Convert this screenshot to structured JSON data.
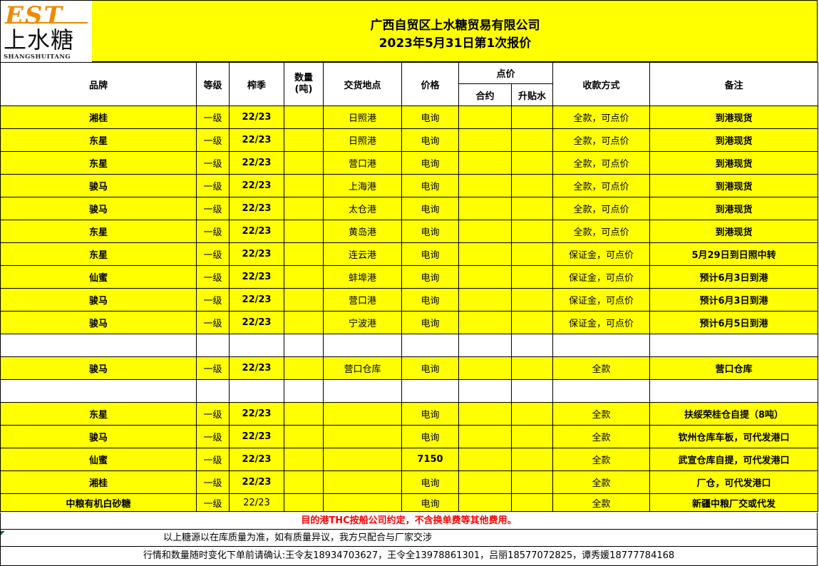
{
  "logo": {
    "mark": "EST",
    "name_cn": "上水糖",
    "name_en": "SHANGSHUITANG"
  },
  "title": {
    "company": "广西自贸区上水糖贸易有限公司",
    "date_line": "2023年5月31日第1次报价"
  },
  "headers": {
    "brand": "品牌",
    "grade": "等级",
    "season": "榨季",
    "qty_line1": "数量",
    "qty_line2": "(吨)",
    "location": "交货地点",
    "price": "价格",
    "point_price": "点价",
    "contract": "合约",
    "premium": "升贴水",
    "payment": "收款方式",
    "remark": "备注"
  },
  "rows": [
    {
      "brand": "湘桂",
      "grade": "一级",
      "season": "22/23",
      "qty": "",
      "location": "日照港",
      "price": "电询",
      "contract": "",
      "premium": "",
      "payment": "全款，可点价",
      "remark": "到港现货"
    },
    {
      "brand": "东星",
      "grade": "一级",
      "season": "22/23",
      "qty": "",
      "location": "日照港",
      "price": "电询",
      "contract": "",
      "premium": "",
      "payment": "全款，可点价",
      "remark": "到港现货"
    },
    {
      "brand": "东星",
      "grade": "一级",
      "season": "22/23",
      "qty": "",
      "location": "营口港",
      "price": "电询",
      "contract": "",
      "premium": "",
      "payment": "全款，可点价",
      "remark": "到港现货"
    },
    {
      "brand": "骏马",
      "grade": "一级",
      "season": "22/23",
      "qty": "",
      "location": "上海港",
      "price": "电询",
      "contract": "",
      "premium": "",
      "payment": "全款，可点价",
      "remark": "到港现货"
    },
    {
      "brand": "骏马",
      "grade": "一级",
      "season": "22/23",
      "qty": "",
      "location": "太仓港",
      "price": "电询",
      "contract": "",
      "premium": "",
      "payment": "全款，可点价",
      "remark": "到港现货"
    },
    {
      "brand": "东星",
      "grade": "一级",
      "season": "22/23",
      "qty": "",
      "location": "黄岛港",
      "price": "电询",
      "contract": "",
      "premium": "",
      "payment": "全款，可点价",
      "remark": "到港现货"
    },
    {
      "brand": "东星",
      "grade": "一级",
      "season": "22/23",
      "qty": "",
      "location": "连云港",
      "price": "电询",
      "contract": "",
      "premium": "",
      "payment": "保证金，可点价",
      "remark": "5月29日到日照中转"
    },
    {
      "brand": "仙蜜",
      "grade": "一级",
      "season": "22/23",
      "qty": "",
      "location": "蚌埠港",
      "price": "电询",
      "contract": "",
      "premium": "",
      "payment": "保证金，可点价",
      "remark": "预计6月3日到港"
    },
    {
      "brand": "骏马",
      "grade": "一级",
      "season": "22/23",
      "qty": "",
      "location": "营口港",
      "price": "电询",
      "contract": "",
      "premium": "",
      "payment": "保证金，可点价",
      "remark": "预计6月3日到港"
    },
    {
      "brand": "骏马",
      "grade": "一级",
      "season": "22/23",
      "qty": "",
      "location": "宁波港",
      "price": "电询",
      "contract": "",
      "premium": "",
      "payment": "保证金，可点价",
      "remark": "预计6月5日到港"
    }
  ],
  "rows_b": [
    {
      "brand": "骏马",
      "grade": "一级",
      "season": "22/23",
      "qty": "",
      "location": "营口仓库",
      "price": "电询",
      "contract": "",
      "premium": "",
      "payment": "全款",
      "remark": "营口仓库"
    }
  ],
  "rows_c": [
    {
      "brand": "东星",
      "grade": "一级",
      "season": "22/23",
      "qty": "",
      "location": "",
      "price": "电询",
      "contract": "",
      "premium": "",
      "payment": "全款",
      "remark": "扶绥荣桂仓自提（8吨）"
    },
    {
      "brand": "骏马",
      "grade": "一级",
      "season": "22/23",
      "qty": "",
      "location": "",
      "price": "电询",
      "contract": "",
      "premium": "",
      "payment": "全款",
      "remark": "钦州仓库车板，可代发港口"
    },
    {
      "brand": "仙蜜",
      "grade": "一级",
      "season": "22/23",
      "qty": "",
      "location": "",
      "price": "7150",
      "contract": "",
      "premium": "",
      "payment": "全款",
      "remark": "武宣仓库自提，可代发港口"
    },
    {
      "brand": "湘桂",
      "grade": "一级",
      "season": "22/23",
      "qty": "",
      "location": "",
      "price": "电询",
      "contract": "",
      "premium": "",
      "payment": "全款",
      "remark": "厂仓，可代发港口"
    },
    {
      "brand": "中粮有机白砂糖",
      "grade": "一级",
      "season": "22/23",
      "qty": "",
      "location": "",
      "price": "电询",
      "contract": "",
      "premium": "",
      "payment": "全款",
      "remark": "新疆中粮厂交或代发"
    }
  ],
  "footer": {
    "note1": "目的港THC按船公司约定，不含换单费等其他费用。",
    "note2": "以上糖源以在库质量为准，如有质量异议，我方只配合与厂家交涉",
    "note3": "行情和数量随时变化下单前请确认:王令友18934703627，王令全13978861301，吕丽18577072825，谭秀媛18777784168"
  },
  "colors": {
    "highlight": "#ffff00",
    "accent_red": "#ff0000",
    "logo_orange": "#f08a00"
  }
}
